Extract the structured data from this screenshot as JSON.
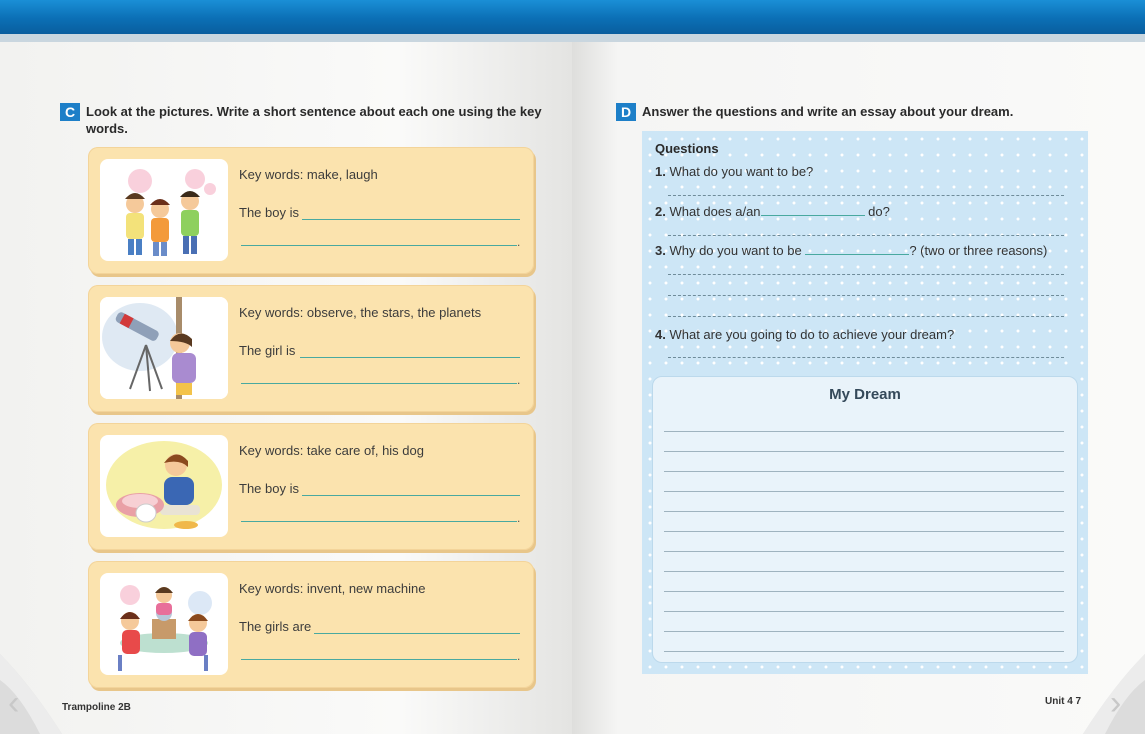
{
  "left_page": {
    "section_c": {
      "badge": "C",
      "instruction_line1": "Look at the pictures. Write a short sentence about each one using the key",
      "instruction_line2": "words."
    },
    "cards": [
      {
        "keywords": "Key words: make, laugh",
        "prompt": "The boy is"
      },
      {
        "keywords": "Key words: observe, the stars, the planets",
        "prompt": "The girl is"
      },
      {
        "keywords": "Key words: take care of, his dog",
        "prompt": "The boy is"
      },
      {
        "keywords": "Key words: invent, new machine",
        "prompt": "The girls are"
      }
    ],
    "period": ".",
    "footer": "Trampoline 2B"
  },
  "right_page": {
    "section_d": {
      "badge": "D",
      "instruction": "Answer the questions and write an essay about your dream."
    },
    "questions_title": "Questions",
    "questions": [
      {
        "num": "1.",
        "text": "What do you want to be?"
      },
      {
        "num": "2.",
        "text_before": "What does a/an",
        "text_after": "do?"
      },
      {
        "num": "3.",
        "text_before": "Why do you want to be",
        "text_after": "? (two or three reasons)"
      },
      {
        "num": "4.",
        "text": "What are you going to do to achieve your dream?"
      }
    ],
    "dream_title": "My Dream",
    "footer": "Unit 4 7"
  },
  "colors": {
    "header_blue": "#0b6fb5",
    "badge_blue": "#1d7fc8",
    "card_bg": "#fbe3ae",
    "question_bg": "#cde6f6",
    "answer_line": "#49a9a0"
  }
}
